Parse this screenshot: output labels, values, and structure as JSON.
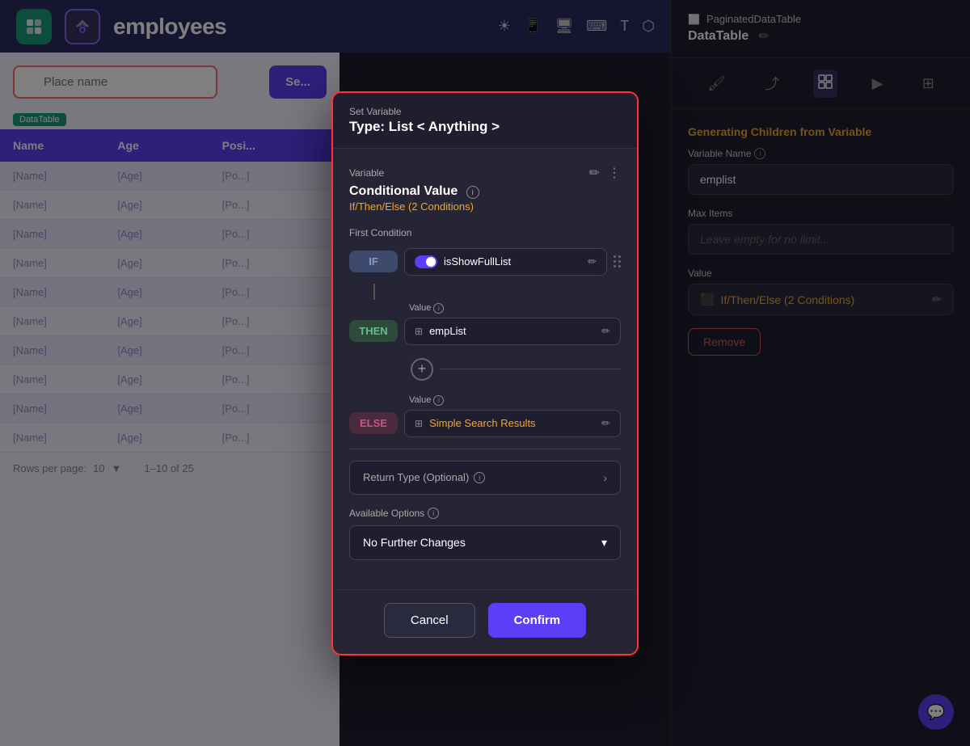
{
  "app": {
    "title": "employees",
    "tab_name": "PaginatedDataTable",
    "subtitle": "DataTable"
  },
  "toolbar": {
    "items": [
      "☀",
      "📱",
      "⬜",
      "⌨",
      "T",
      "⬡"
    ]
  },
  "search": {
    "placeholder": "Place name",
    "button_label": "Se..."
  },
  "datatable_label": "DataTable",
  "table": {
    "columns": [
      "Name",
      "Age",
      "Posi..."
    ],
    "rows": [
      [
        "[Name]",
        "[Age]",
        "[Po...]"
      ],
      [
        "[Name]",
        "[Age]",
        "[Po...]"
      ],
      [
        "[Name]",
        "[Age]",
        "[Po...]"
      ],
      [
        "[Name]",
        "[Age]",
        "[Po...]"
      ],
      [
        "[Name]",
        "[Age]",
        "[Po...]"
      ],
      [
        "[Name]",
        "[Age]",
        "[Po...]"
      ],
      [
        "[Name]",
        "[Age]",
        "[Po...]"
      ],
      [
        "[Name]",
        "[Age]",
        "[Po...]"
      ],
      [
        "[Name]",
        "[Age]",
        "[Po...]"
      ],
      [
        "[Name]",
        "[Age]",
        "[Po...]"
      ]
    ],
    "footer": {
      "rows_per_page_label": "Rows per page:",
      "rows_per_page_value": "10",
      "pagination": "1–10 of 25"
    }
  },
  "right_panel": {
    "component_label": "PaginatedDataTable",
    "component_name": "DataTable",
    "section_title": "Generating Children from Variable",
    "variable_name_label": "Variable Name",
    "variable_name_value": "emplist",
    "variable_name_placeholder": "emplist",
    "max_items_label": "Max Items",
    "max_items_placeholder": "Leave empty for no limit...",
    "value_label": "Value",
    "value_text": "If/Then/Else (2 Conditions)",
    "remove_button_label": "Remove"
  },
  "modal": {
    "type_label": "Set Variable",
    "type_value": "Type: List < Anything >",
    "variable_section_label": "Variable",
    "variable_name": "Conditional Value",
    "variable_subtitle": "If/Then/Else (2 Conditions)",
    "first_condition_label": "First Condition",
    "if_value": "isShowFullList",
    "then_label": "Value",
    "then_value": "empList",
    "else_label": "Value",
    "else_value": "Simple Search Results",
    "return_type_label": "Return Type (Optional)",
    "available_options_label": "Available Options",
    "available_options_value": "No Further Changes",
    "cancel_label": "Cancel",
    "confirm_label": "Confirm",
    "leave_empty_hint": "Leave empty for no"
  },
  "colors": {
    "accent_purple": "#5b3ef5",
    "accent_orange": "#f5a623",
    "accent_green": "#1a9b7b",
    "badge_if": "#3d4a6b",
    "badge_then": "#2d4a3d",
    "badge_else": "#4a2a3d",
    "modal_border": "#ff3333"
  }
}
